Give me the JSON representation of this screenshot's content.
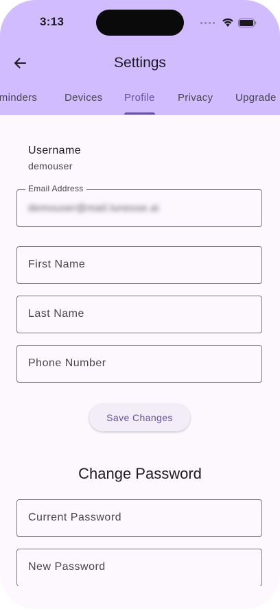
{
  "status_bar": {
    "time": "3:13"
  },
  "app_bar": {
    "title": "Settings",
    "back_icon": "arrow-left-icon"
  },
  "tabs": [
    {
      "label": "Reminders",
      "active": false
    },
    {
      "label": "Devices",
      "active": false
    },
    {
      "label": "Profile",
      "active": true
    },
    {
      "label": "Privacy",
      "active": false
    },
    {
      "label": "Upgrade",
      "active": false
    }
  ],
  "profile": {
    "username_label": "Username",
    "username_value": "demouser",
    "email": {
      "label": "Email Address",
      "value": "demouser@mail.lunesse.ai"
    },
    "first_name": {
      "placeholder": "First Name"
    },
    "last_name": {
      "placeholder": "Last Name"
    },
    "phone": {
      "placeholder": "Phone Number"
    },
    "save_label": "Save Changes"
  },
  "password": {
    "section_title": "Change Password",
    "current": {
      "placeholder": "Current Password"
    },
    "new": {
      "placeholder": "New Password"
    }
  },
  "colors": {
    "app_bar": "#d0bcfe",
    "background": "#fdf7fe",
    "accent": "#6750a4",
    "outline": "#79747e"
  }
}
